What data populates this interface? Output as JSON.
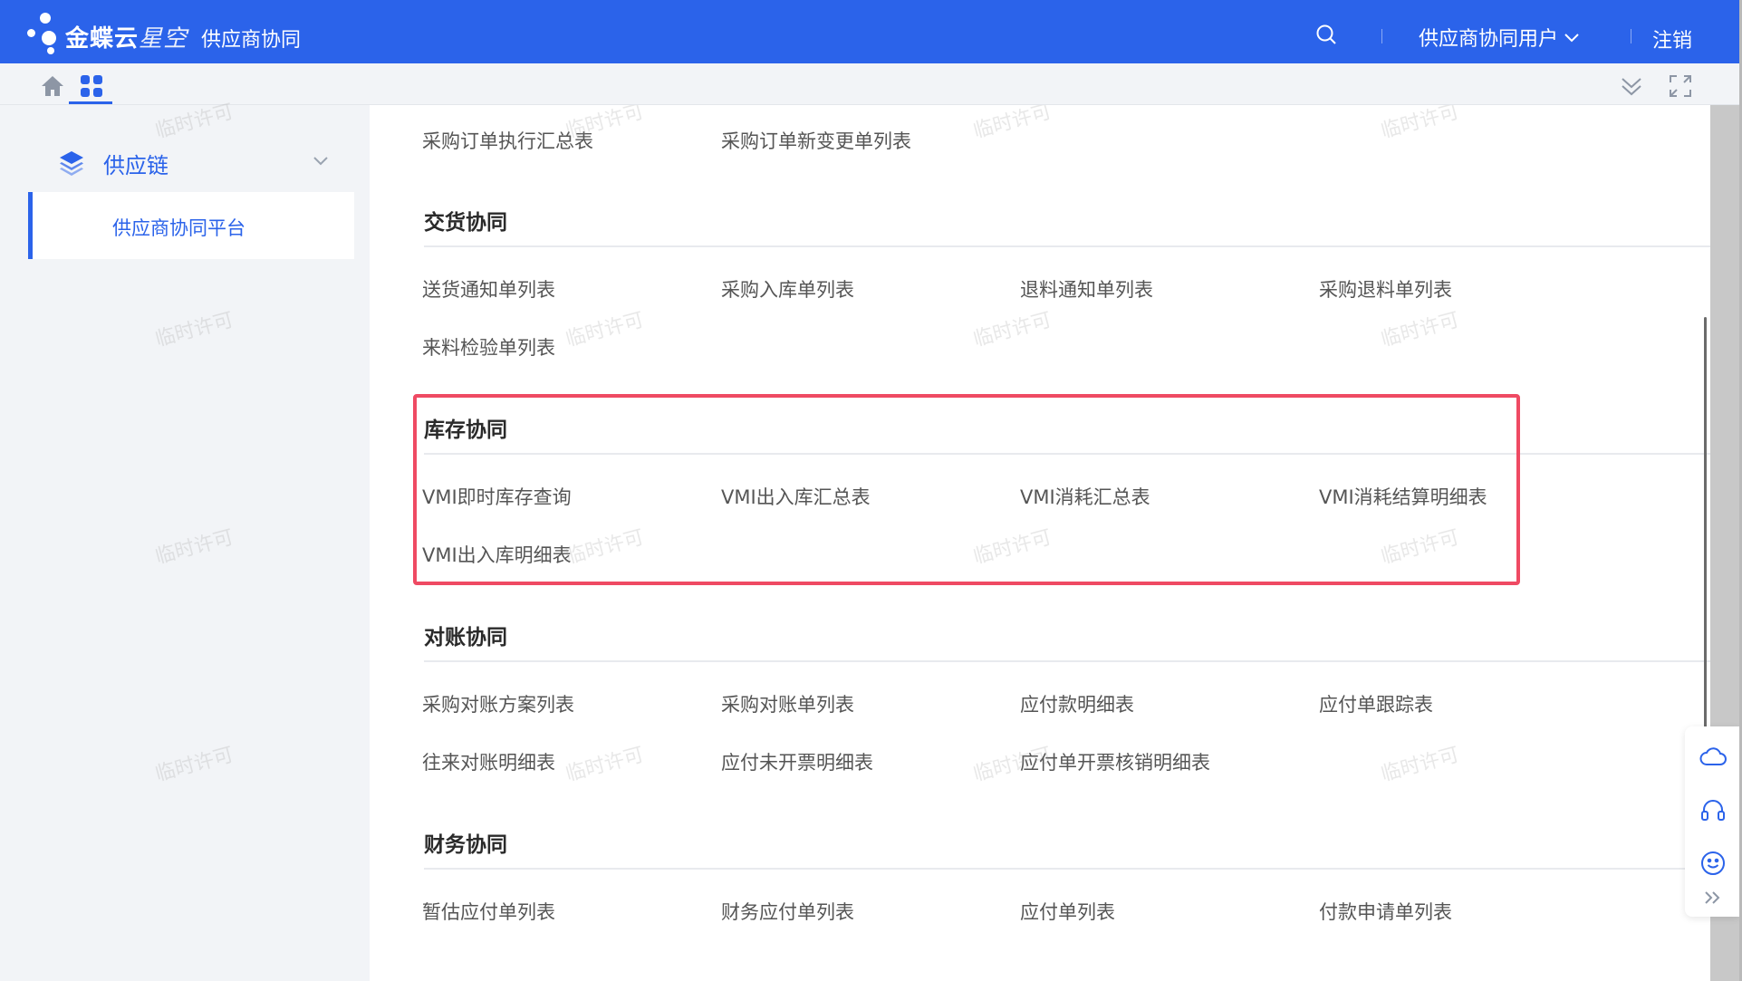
{
  "header": {
    "brand_main": "金蝶云",
    "brand_italic": "星空",
    "brand_sub": "供应商协同",
    "user_menu": "供应商协同用户",
    "logout": "注销"
  },
  "sidebar": {
    "group_label": "供应链",
    "item_label": "供应商协同平台"
  },
  "sections": {
    "top_row": [
      "采购订单执行汇总表",
      "采购订单新变更单列表"
    ],
    "delivery": {
      "title": "交货协同",
      "row1": [
        "送货通知单列表",
        "采购入库单列表",
        "退料通知单列表",
        "采购退料单列表"
      ],
      "row2": [
        "来料检验单列表"
      ]
    },
    "inventory": {
      "title": "库存协同",
      "row1": [
        "VMI即时库存查询",
        "VMI出入库汇总表",
        "VMI消耗汇总表",
        "VMI消耗结算明细表"
      ],
      "row2": [
        "VMI出入库明细表"
      ]
    },
    "reconcile": {
      "title": "对账协同",
      "row1": [
        "采购对账方案列表",
        "采购对账单列表",
        "应付款明细表",
        "应付单跟踪表"
      ],
      "row2": [
        "往来对账明细表",
        "应付未开票明细表",
        "应付单开票核销明细表"
      ]
    },
    "finance": {
      "title": "财务协同",
      "row1": [
        "暂估应付单列表",
        "财务应付单列表",
        "应付单列表",
        "付款申请单列表"
      ]
    }
  },
  "watermark": "临时许可",
  "colors": {
    "brand_blue": "#2b63ea",
    "highlight_red": "#ef4a63"
  },
  "icons": [
    "search-icon",
    "chevron-down-icon",
    "home-icon",
    "apps-grid-icon",
    "collapse-icon",
    "fullscreen-icon",
    "layers-icon",
    "cloud-icon",
    "headset-icon",
    "smile-icon",
    "double-chevron-right-icon"
  ]
}
